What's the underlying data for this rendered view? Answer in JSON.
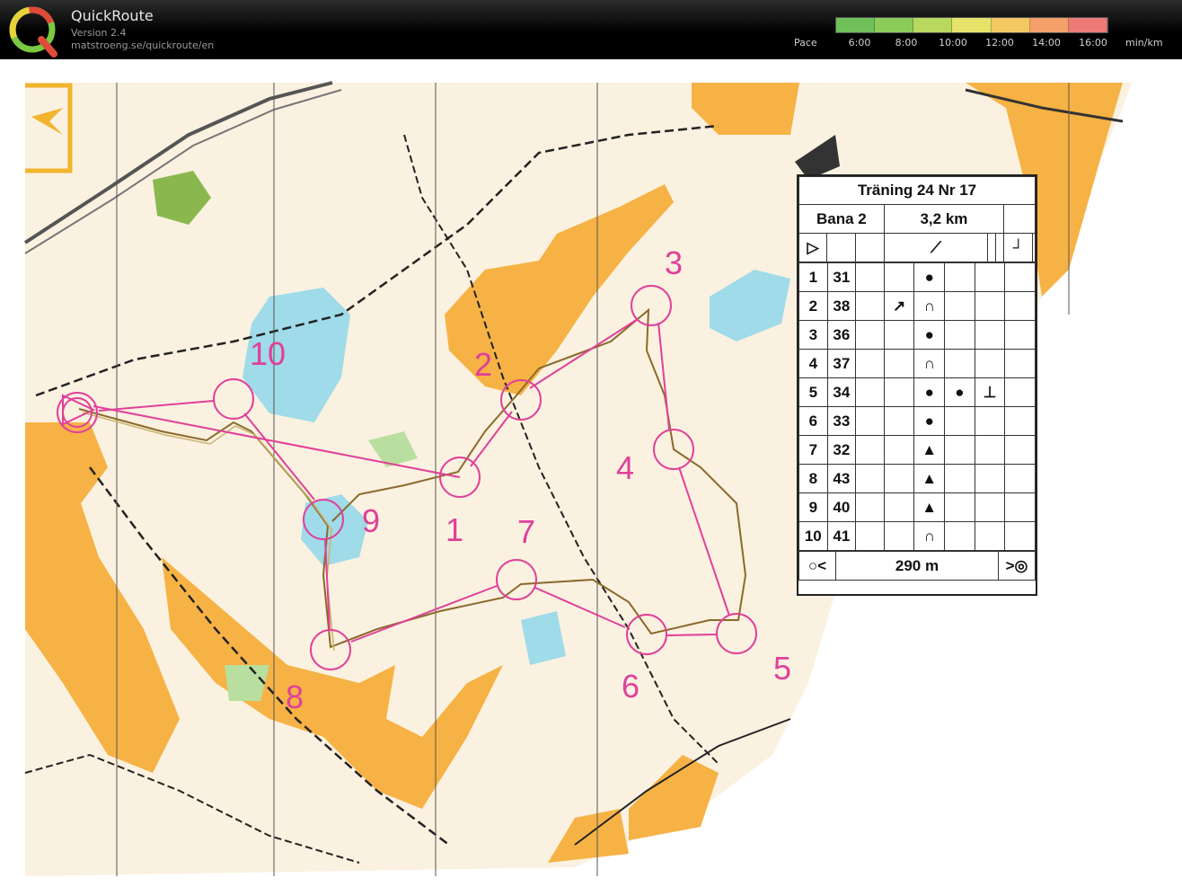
{
  "app": {
    "name": "QuickRoute",
    "version": "Version 2.4",
    "url": "matstroeng.se/quickroute/en"
  },
  "pace_scale": {
    "label": "Pace",
    "ticks": [
      "6:00",
      "8:00",
      "10:00",
      "12:00",
      "14:00",
      "16:00"
    ],
    "unit": "min/km",
    "colors": [
      "#6fbf5a",
      "#8ccb5a",
      "#b8d85e",
      "#e6e26a",
      "#f3c863",
      "#f3a06a",
      "#ee7a78"
    ]
  },
  "map": {
    "background_color": "#fdfdfb",
    "course_color": "#e0409a",
    "route_color": "#8a6a2a",
    "control_numbers": [
      "1",
      "2",
      "3",
      "4",
      "5",
      "6",
      "7",
      "8",
      "9",
      "10"
    ]
  },
  "control_description": {
    "title": "Träning 24 Nr 17",
    "course": "Bana 2",
    "length": "3,2 km",
    "start_symbol": "▷",
    "controls": [
      {
        "num": "1",
        "code": "31",
        "dir": "",
        "feature": "●",
        "detail": "",
        "extra": ""
      },
      {
        "num": "2",
        "code": "38",
        "dir": "↗",
        "feature": "∩",
        "detail": "",
        "extra": ""
      },
      {
        "num": "3",
        "code": "36",
        "dir": "",
        "feature": "●",
        "detail": "",
        "extra": ""
      },
      {
        "num": "4",
        "code": "37",
        "dir": "",
        "feature": "∩",
        "detail": "",
        "extra": ""
      },
      {
        "num": "5",
        "code": "34",
        "dir": "",
        "feature": "●",
        "detail": "●",
        "extra": "⊥"
      },
      {
        "num": "6",
        "code": "33",
        "dir": "",
        "feature": "●",
        "detail": "",
        "extra": ""
      },
      {
        "num": "7",
        "code": "32",
        "dir": "",
        "feature": "▲",
        "detail": "",
        "extra": ""
      },
      {
        "num": "8",
        "code": "43",
        "dir": "",
        "feature": "▲",
        "detail": "",
        "extra": ""
      },
      {
        "num": "9",
        "code": "40",
        "dir": "",
        "feature": "▲",
        "detail": "",
        "extra": ""
      },
      {
        "num": "10",
        "code": "41",
        "dir": "",
        "feature": "∩",
        "detail": "",
        "extra": ""
      }
    ],
    "finish_distance": "290 m"
  }
}
